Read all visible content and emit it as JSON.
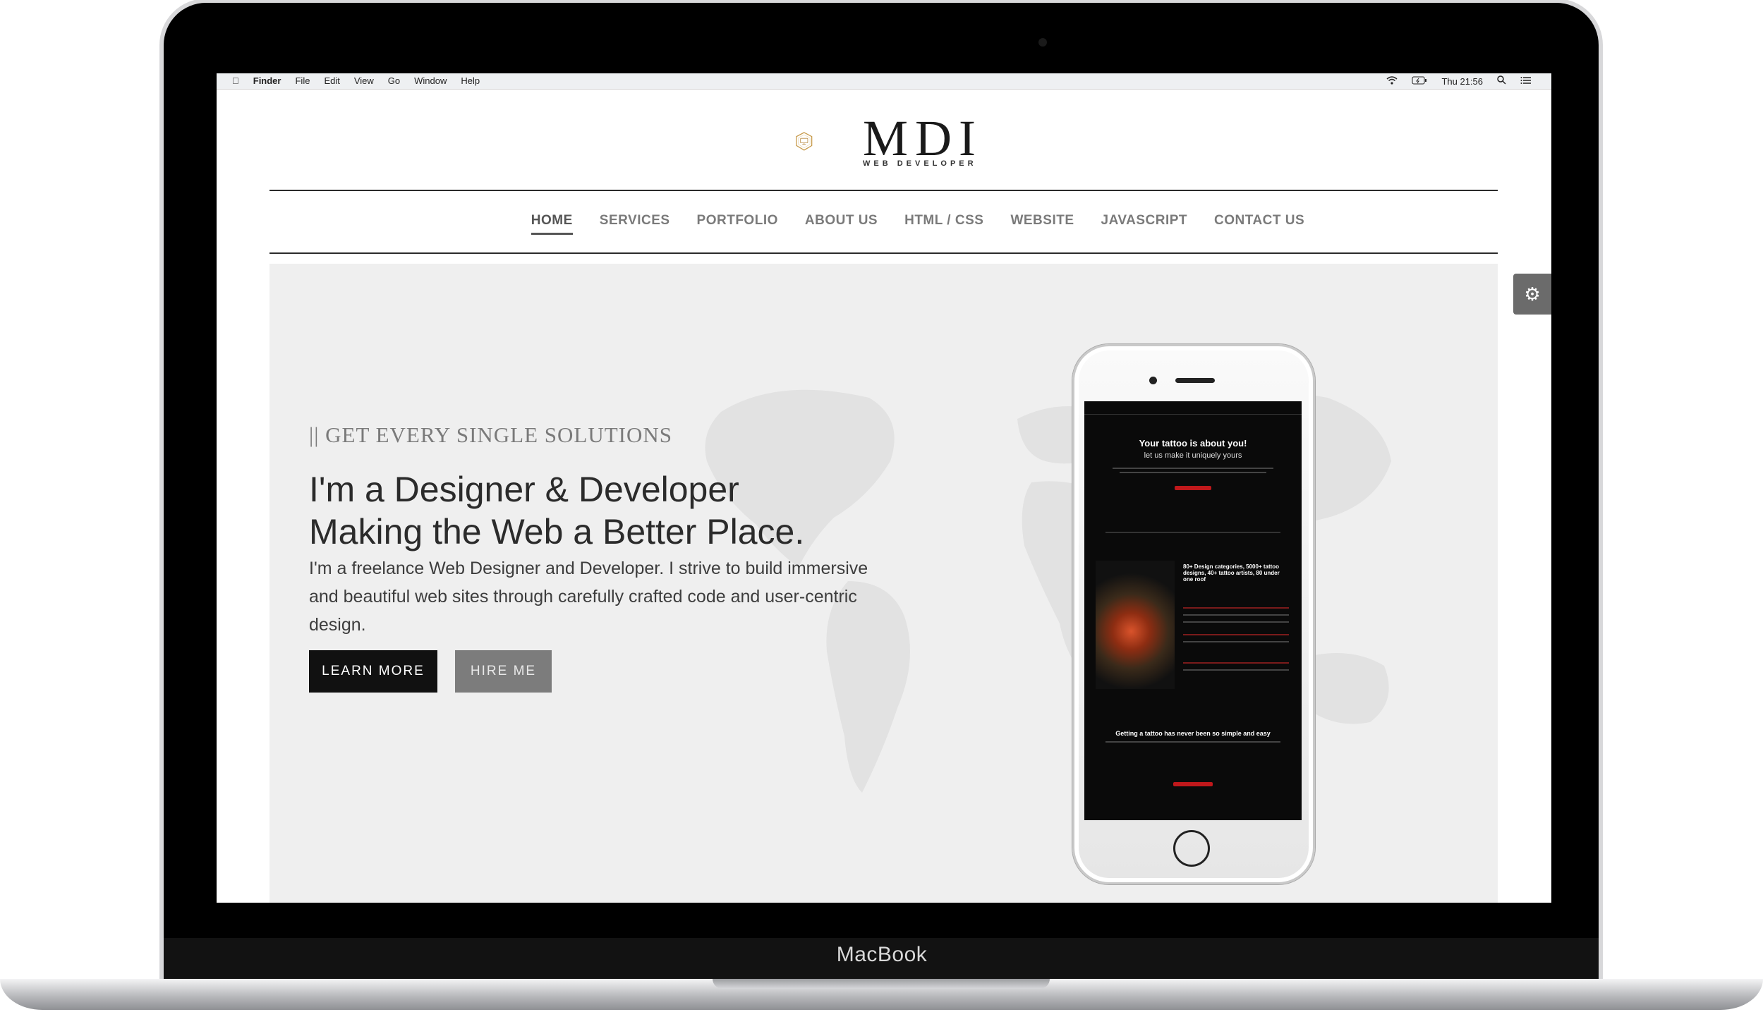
{
  "device": {
    "brand": "MacBook"
  },
  "menubar": {
    "items": [
      "Finder",
      "File",
      "Edit",
      "View",
      "Go",
      "Window",
      "Help"
    ],
    "clock": "Thu 21:56"
  },
  "site": {
    "logo_text": "MDI",
    "logo_sub": "WEB DEVELOPER",
    "nav": [
      "HOME",
      "SERVICES",
      "PORTFOLIO",
      "ABOUT US",
      "HTML / CSS",
      "WEBSITE",
      "JAVASCRIPT",
      "CONTACT US"
    ],
    "active_nav": "HOME"
  },
  "hero": {
    "kicker": "|| GET EVERY SINGLE SOLUTIONS",
    "headline_line1": "I'm a Designer & Developer",
    "headline_line2": "Making the Web a Better Place.",
    "description": "I'm a freelance Web Designer and Developer. I strive to build immersive and beautiful web sites through carefully crafted code and user-centric design.",
    "learn_more": "LEARN MORE",
    "hire_me": "HIRE ME"
  },
  "phone_preview": {
    "title": "Your tattoo is about you!",
    "subtitle": "let us make it uniquely yours",
    "side_heading": "80+ Design categories, 5000+ tattoo designs, 40+ tattoo artists, 80 under one roof",
    "footer_heading": "Getting a tattoo has never been so simple and easy"
  },
  "colors": {
    "accent_dark": "#111111",
    "nav_gray": "#7a7a7a",
    "hero_bg": "#efefef",
    "phone_red": "#c0181b"
  },
  "icons": [
    "apple-icon",
    "wifi-icon",
    "battery-icon",
    "spotlight-search-icon",
    "notification-center-icon",
    "gear-icon",
    "logo-hexagon-icon"
  ]
}
